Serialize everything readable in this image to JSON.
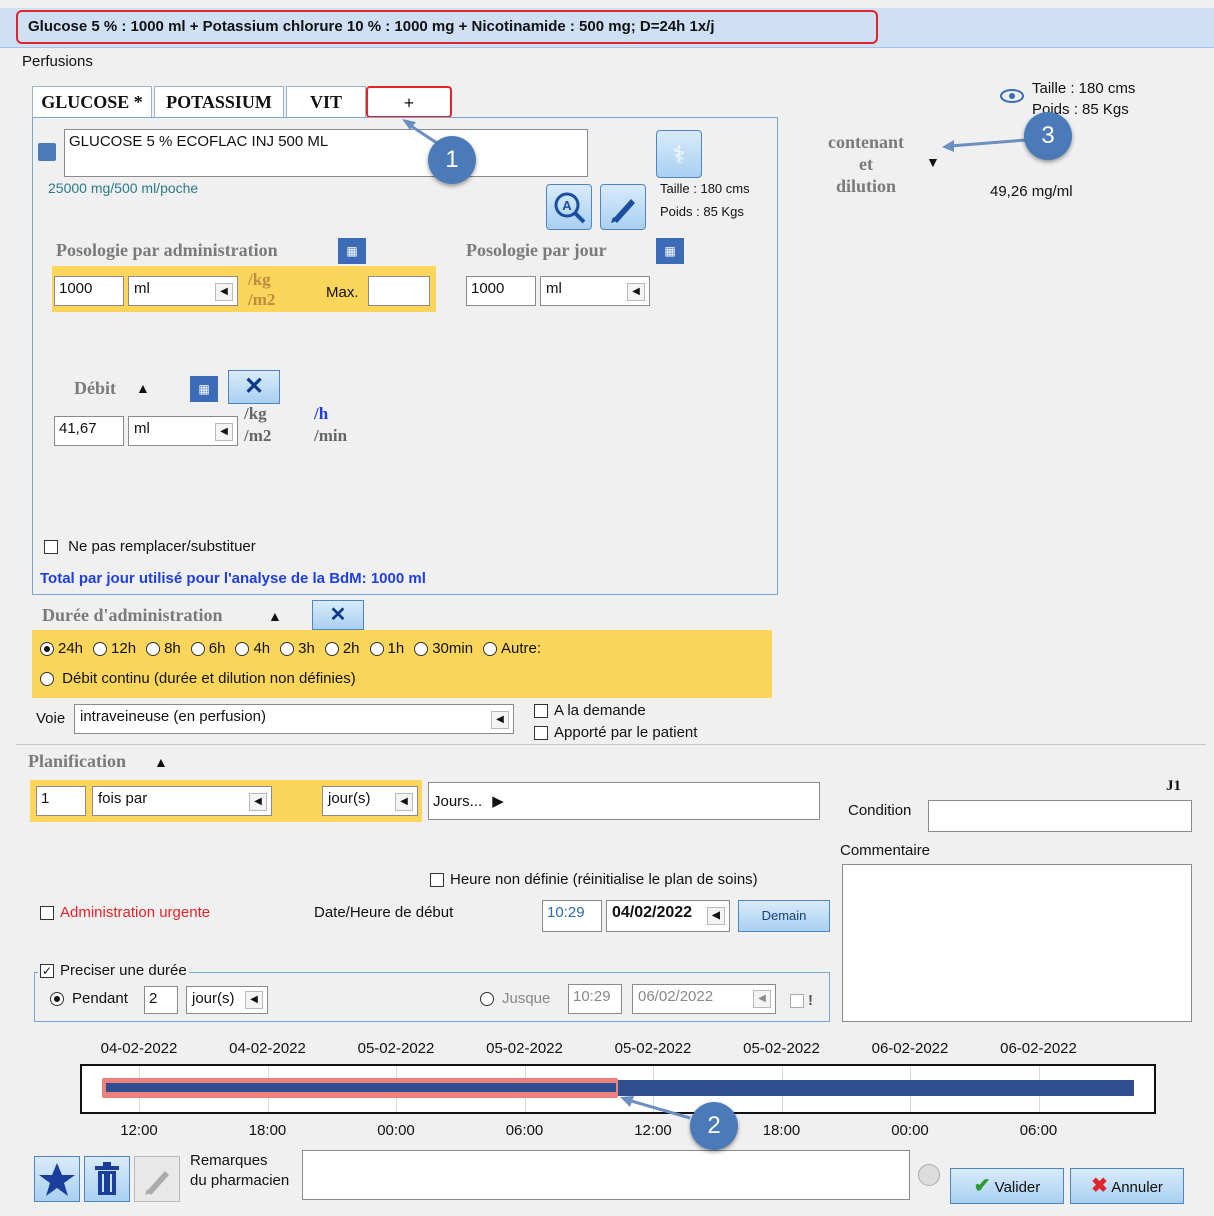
{
  "window_title": "Glucose 5 % : 1000 ml + Potassium chlorure 10 % : 1000 mg + Nicotinamide : 500 mg; D=24h 1x/j",
  "perfusions_label": "Perfusions",
  "tabs": [
    "GLUCOSE *",
    "POTASSIUM",
    "VIT",
    "+"
  ],
  "drug": {
    "name": "GLUCOSE 5 % ECOFLAC INJ 500 ML",
    "concentration": "25000 mg/500 ml/poche",
    "taille_small": "Taille : 180 cms",
    "poids_small": "Poids : 85 Kgs"
  },
  "posologie_admin": {
    "label": "Posologie par administration",
    "value": "1000",
    "unit": "ml",
    "per": "/kg",
    "per2": "/m2",
    "max_label": "Max.",
    "max_value": ""
  },
  "posologie_jour": {
    "label": "Posologie par jour",
    "value": "1000",
    "unit": "ml"
  },
  "debit": {
    "label": "Débit",
    "value": "41,67",
    "unit": "ml",
    "per": "/kg",
    "per2": "/m2",
    "rate_h": "/h",
    "rate_min": "/min"
  },
  "ne_pas_remplacer": "Ne pas remplacer/substituer",
  "total_jour": "Total par jour utilisé pour l'analyse de la BdM: 1000 ml",
  "duree": {
    "label": "Durée d'administration",
    "options": [
      "24h",
      "12h",
      "8h",
      "6h",
      "4h",
      "3h",
      "2h",
      "1h",
      "30min",
      "Autre:"
    ],
    "continu": "Débit continu (durée et dilution non définies)"
  },
  "voie": {
    "label": "Voie",
    "value": "intraveineuse (en perfusion)",
    "a_la_demande": "A la demande",
    "apporte": "Apporté par le patient"
  },
  "right_info": {
    "taille": "Taille : 180 cms",
    "poids": "Poids : 85 Kgs",
    "contenant_1": "contenant",
    "contenant_2": "et",
    "contenant_3": "dilution",
    "concentration": "49,26 mg/ml"
  },
  "planification": {
    "label": "Planification",
    "fois_value": "1",
    "fois_unit": "fois par",
    "periode": "jour(s)",
    "jours": "Jours...",
    "j1": "J1",
    "condition_label": "Condition",
    "commentaire_label": "Commentaire"
  },
  "heure_non_definie": "Heure non définie (réinitialise le plan de soins)",
  "urgente": "Administration urgente",
  "date_debut_label": "Date/Heure de début",
  "heure_debut": "10:29",
  "date_debut": "04/02/2022",
  "demain": "Demain",
  "duree_precise": {
    "label": "Preciser une durée",
    "pendant": "Pendant",
    "pendant_value": "2",
    "pendant_unit": "jour(s)",
    "jusque": "Jusque",
    "jusque_heure": "10:29",
    "jusque_date": "06/02/2022",
    "excl": "!"
  },
  "timeline": {
    "dates": [
      "04-02-2022",
      "04-02-2022",
      "05-02-2022",
      "05-02-2022",
      "05-02-2022",
      "05-02-2022",
      "06-02-2022",
      "06-02-2022"
    ],
    "times": [
      "12:00",
      "18:00",
      "00:00",
      "06:00",
      "12:00",
      "18:00",
      "00:00",
      "06:00"
    ]
  },
  "bottom": {
    "remarques_1": "Remarques",
    "remarques_2": "du pharmacien",
    "valider": "Valider",
    "annuler": "Annuler"
  },
  "callouts": [
    "1",
    "2",
    "3"
  ],
  "colors": {
    "accent_red": "#e0252a",
    "yellow": "#fbd65a",
    "badge": "#4a7ab8",
    "bar_dark": "#2f4f8f",
    "bar_pink": "#f08080"
  }
}
